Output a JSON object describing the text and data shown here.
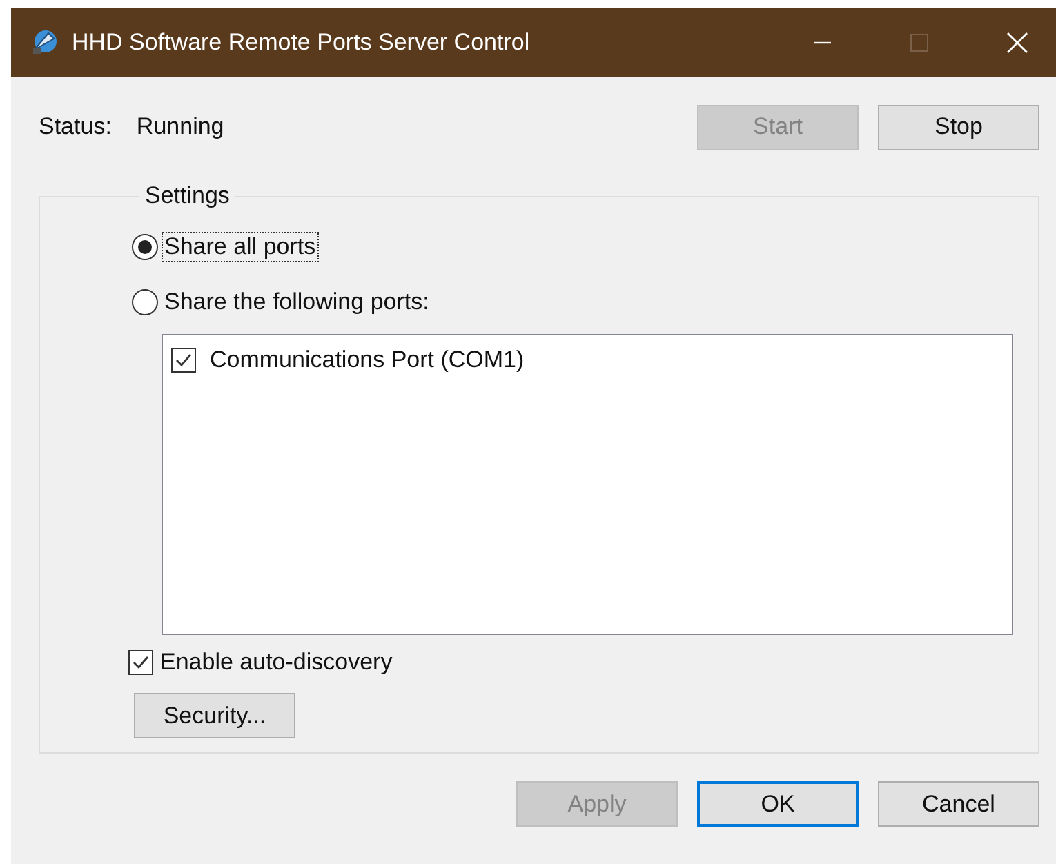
{
  "window": {
    "title": "HHD Software Remote Ports Server Control",
    "maximize_disabled": true
  },
  "status": {
    "label": "Status:",
    "value": "Running"
  },
  "top_buttons": [
    {
      "label": "Start",
      "disabled": true
    },
    {
      "label": "Stop",
      "disabled": false
    }
  ],
  "settings": {
    "title": "Settings",
    "options": [
      {
        "label": "Share all ports",
        "selected": true,
        "focused": true
      },
      {
        "label": "Share the following ports:",
        "selected": false,
        "focused": false
      }
    ],
    "ports": [
      {
        "label": "Communications Port (COM1)",
        "checked": true
      }
    ],
    "auto_discovery": {
      "label": "Enable auto-discovery",
      "checked": true
    },
    "security_button": "Security..."
  },
  "bottom_buttons": [
    {
      "label": "Apply",
      "disabled": true,
      "default": false
    },
    {
      "label": "OK",
      "disabled": false,
      "default": true
    },
    {
      "label": "Cancel",
      "disabled": false,
      "default": false
    }
  ]
}
